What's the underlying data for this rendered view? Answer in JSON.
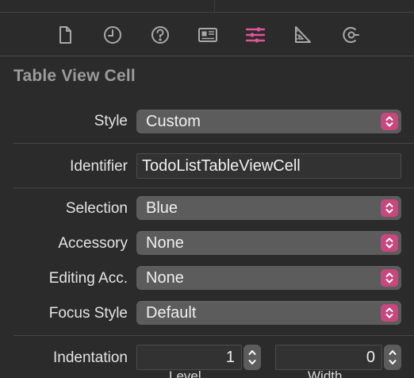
{
  "tabs": [
    {
      "name": "file-inspector",
      "icon": "document-icon",
      "active": false
    },
    {
      "name": "history-inspector",
      "icon": "clock-icon",
      "active": false
    },
    {
      "name": "quick-help-inspector",
      "icon": "question-mark-icon",
      "active": false
    },
    {
      "name": "identity-inspector",
      "icon": "id-card-icon",
      "active": false
    },
    {
      "name": "attributes-inspector",
      "icon": "sliders-icon",
      "active": true
    },
    {
      "name": "size-inspector",
      "icon": "ruler-triangle-icon",
      "active": false
    },
    {
      "name": "connections-inspector",
      "icon": "connection-arrow-icon",
      "active": false
    }
  ],
  "colors": {
    "accent": "#e0559a",
    "popup_chevron": "#c8477e",
    "background": "#2b2b2b",
    "popup_bg": "#5c5c5c"
  },
  "section": {
    "title": "Table View Cell"
  },
  "style": {
    "label": "Style",
    "value": "Custom"
  },
  "identifier": {
    "label": "Identifier",
    "value": "TodoListTableViewCell"
  },
  "selection": {
    "label": "Selection",
    "value": "Blue"
  },
  "accessory": {
    "label": "Accessory",
    "value": "None"
  },
  "editing_accessory": {
    "label": "Editing Acc.",
    "value": "None"
  },
  "focus_style": {
    "label": "Focus Style",
    "value": "Default"
  },
  "indentation": {
    "label": "Indentation",
    "level_value": "1",
    "width_value": "0",
    "level_label": "Level",
    "width_label": "Width"
  }
}
